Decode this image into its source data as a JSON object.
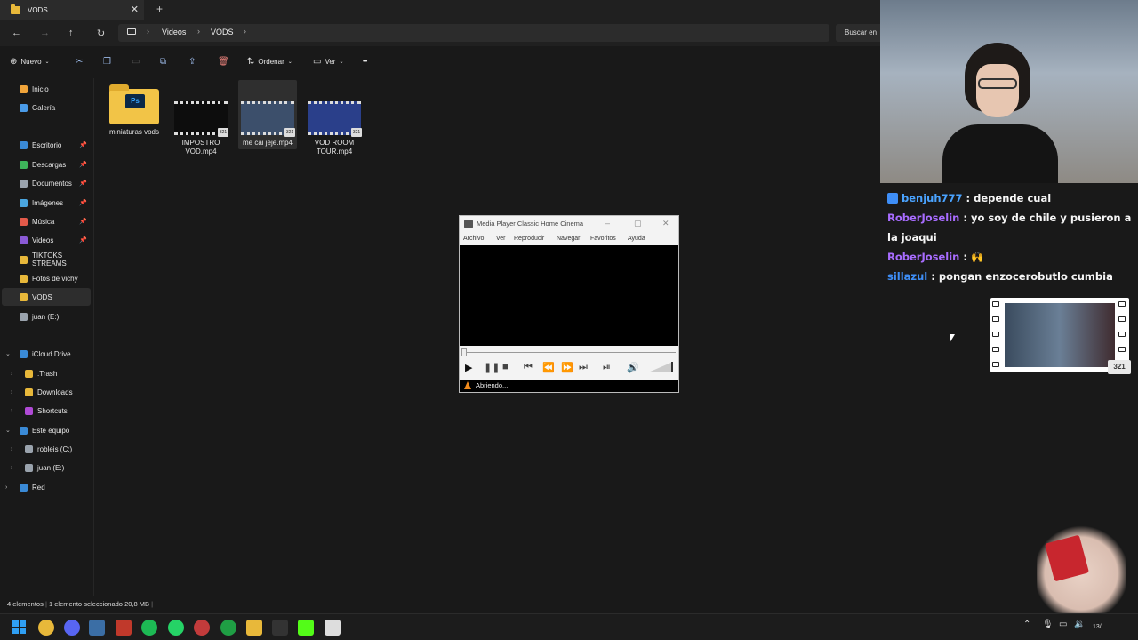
{
  "explorer": {
    "tab": {
      "title": "VODS",
      "close_glyph": "✕",
      "add_glyph": "+"
    },
    "nav": {
      "back": "←",
      "forward": "→",
      "up": "↑",
      "refresh": "↻"
    },
    "breadcrumb": [
      "Videos",
      "VODS"
    ],
    "search_placeholder": "Buscar en",
    "toolbar": {
      "new_label": "Nuevo",
      "sort_label": "Ordenar",
      "view_label": "Ver",
      "more_glyph": "•••"
    },
    "sidebar": {
      "items": [
        {
          "label": "Inicio",
          "icon": "home-icon",
          "color": "#f0a43a"
        },
        {
          "label": "Galería",
          "icon": "gallery-icon",
          "color": "#4a9be8"
        },
        {
          "label": "Escritorio",
          "icon": "desktop-icon",
          "color": "#3a8ad6",
          "pinned": true
        },
        {
          "label": "Descargas",
          "icon": "download-icon",
          "color": "#3eb55b",
          "pinned": true
        },
        {
          "label": "Documentos",
          "icon": "documents-icon",
          "color": "#9aa3ad",
          "pinned": true
        },
        {
          "label": "Imágenes",
          "icon": "pictures-icon",
          "color": "#4aa6e0",
          "pinned": true
        },
        {
          "label": "Música",
          "icon": "music-icon",
          "color": "#e35a4a",
          "pinned": true
        },
        {
          "label": "Videos",
          "icon": "videos-icon",
          "color": "#8a5ad6",
          "pinned": true
        },
        {
          "label": "TIKTOKS STREAMS",
          "icon": "folder-icon",
          "color": "#e8b83a"
        },
        {
          "label": "Fotos de vichy",
          "icon": "folder-icon",
          "color": "#e8b83a"
        },
        {
          "label": "VODS",
          "icon": "folder-icon",
          "color": "#e8b83a",
          "selected": true
        },
        {
          "label": "juan (E:)",
          "icon": "drive-icon",
          "color": "#9aa3ad"
        },
        {
          "label": "iCloud Drive",
          "icon": "icloud-icon",
          "color": "#3a8ad6",
          "expanded": true
        },
        {
          "label": ".Trash",
          "icon": "folder-icon",
          "color": "#e8b83a",
          "child": true
        },
        {
          "label": "Downloads",
          "icon": "folder-icon",
          "color": "#e8b83a",
          "child": true
        },
        {
          "label": "Shortcuts",
          "icon": "shortcuts-icon",
          "color": "#b04ad6",
          "child": true
        },
        {
          "label": "Este equipo",
          "icon": "pc-icon",
          "color": "#3a8ad6",
          "expanded": true
        },
        {
          "label": "robleis (C:)",
          "icon": "drive-icon",
          "color": "#9aa3ad",
          "child": true
        },
        {
          "label": "juan (E:)",
          "icon": "drive-icon",
          "color": "#9aa3ad",
          "child": true
        },
        {
          "label": "Red",
          "icon": "network-icon",
          "color": "#3a8ad6"
        }
      ]
    },
    "files": [
      {
        "name": "miniaturas vods",
        "type": "folder"
      },
      {
        "name": "IMPOSTRO VOD.mp4",
        "type": "video",
        "thumb": "#0d0d0d"
      },
      {
        "name": "me cai jeje.mp4",
        "type": "video",
        "thumb": "#3c4f6b",
        "selected": true
      },
      {
        "name": "VOD ROOM TOUR.mp4",
        "type": "video",
        "thumb": "#2a3f8a"
      }
    ],
    "status": {
      "count": "4 elementos",
      "selection": "1 elemento seleccionado",
      "size": "20,8 MB"
    }
  },
  "mpc": {
    "title": "Media Player Classic Home Cinema",
    "menu": [
      "Archivo",
      "Ver",
      "Reproducir",
      "Navegar",
      "Favoritos",
      "Ayuda"
    ],
    "status": "Abriendo...",
    "volume": 1.0
  },
  "chat": {
    "messages": [
      {
        "user": "benjuh777",
        "text": ": depende cual",
        "user_color": "#4aa3ff"
      },
      {
        "user": "RoberJoselin",
        "text": ": yo soy de chile y pusieron a la joaqui",
        "user_color": "#a86cff"
      },
      {
        "user": "RoberJoselin",
        "text": ": 🙌",
        "user_color": "#a86cff"
      },
      {
        "user": "sillazul",
        "text": ": pongan enzocerobutlo cumbia",
        "user_color": "#3e8ef7"
      }
    ]
  },
  "overlay_thumb": {
    "badge": "321"
  },
  "taskbar": {
    "apps": [
      {
        "icon": "chrome-icon",
        "color": "#e8b83a"
      },
      {
        "icon": "discord-icon",
        "color": "#5865f2"
      },
      {
        "icon": "steam-icon",
        "color": "#3b6ea5"
      },
      {
        "icon": "app-red-icon",
        "color": "#c0392b"
      },
      {
        "icon": "spotify-icon",
        "color": "#1db954"
      },
      {
        "icon": "whatsapp-icon",
        "color": "#25d366"
      },
      {
        "icon": "obs-icon",
        "color": "#c23b3b"
      },
      {
        "icon": "xbox-icon",
        "color": "#1f9e44"
      },
      {
        "icon": "explorer-icon",
        "color": "#e8b83a"
      },
      {
        "icon": "epic-icon",
        "color": "#333333"
      },
      {
        "icon": "kick-icon",
        "color": "#53fc18"
      },
      {
        "icon": "clapper-icon",
        "color": "#dddddd"
      }
    ],
    "clock": "13/"
  }
}
